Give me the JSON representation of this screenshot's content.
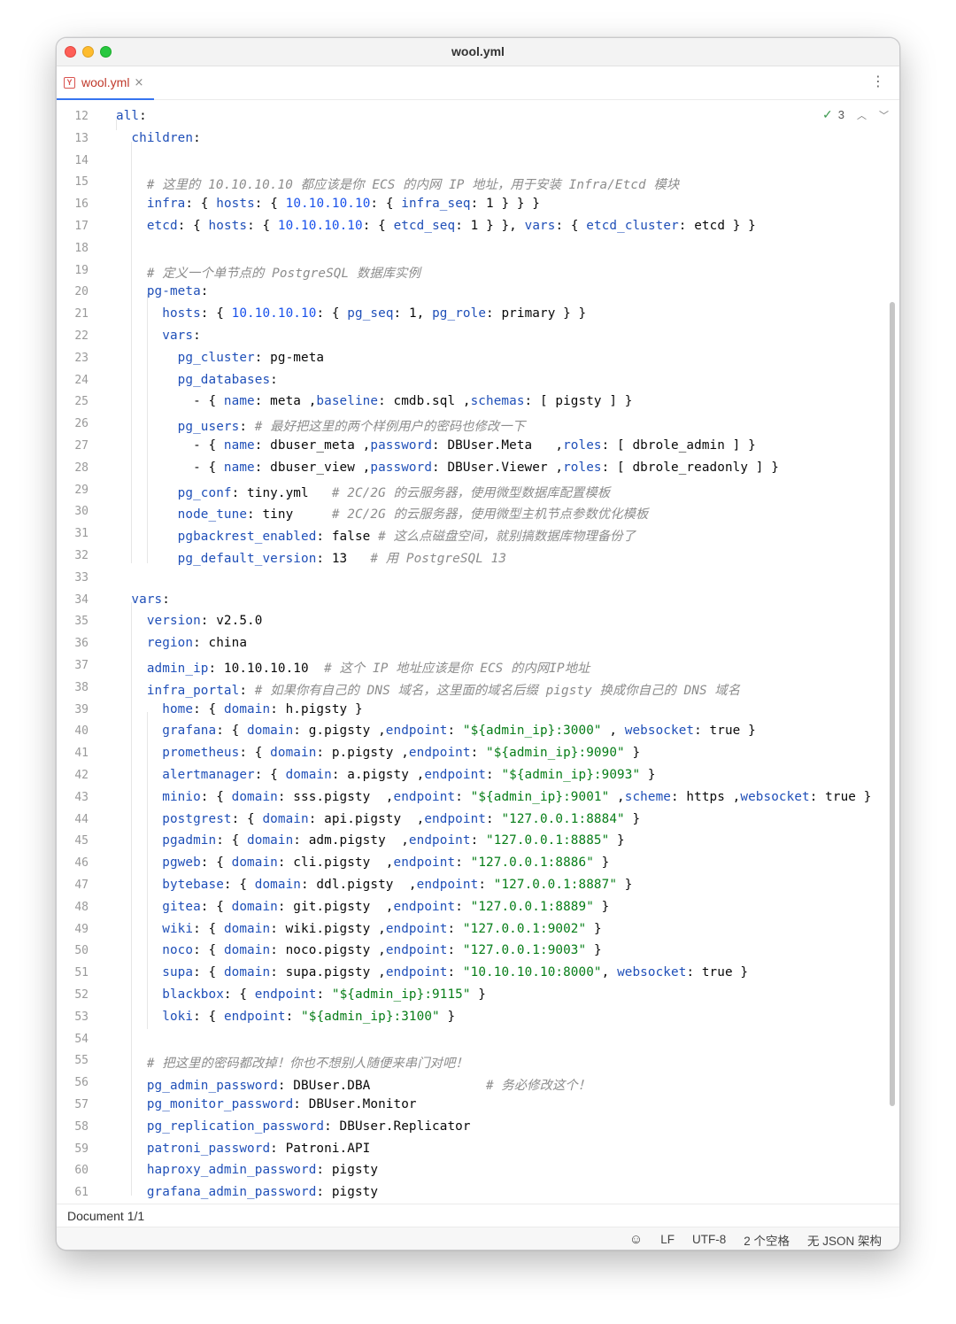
{
  "window": {
    "title": "wool.yml"
  },
  "tab": {
    "label": "wool.yml",
    "close_glyph": "×",
    "menu_glyph": "⋮"
  },
  "inspections": {
    "count": "3"
  },
  "code": [
    {
      "n": "12",
      "t": [
        [
          "k",
          "all"
        ],
        [
          "p",
          ":"
        ]
      ]
    },
    {
      "n": "13",
      "t": [
        [
          "p",
          "  "
        ],
        [
          "k",
          "children"
        ],
        [
          "p",
          ":"
        ]
      ]
    },
    {
      "n": "14",
      "t": []
    },
    {
      "n": "15",
      "t": [
        [
          "p",
          "    "
        ],
        [
          "c",
          "# 这里的 10.10.10.10 都应该是你 ECS 的内网 IP 地址，用于安装 Infra/Etcd 模块"
        ]
      ]
    },
    {
      "n": "16",
      "t": [
        [
          "p",
          "    "
        ],
        [
          "k",
          "infra"
        ],
        [
          "p",
          ": { "
        ],
        [
          "k",
          "hosts"
        ],
        [
          "p",
          ": { "
        ],
        [
          "n",
          "10.10.10.10"
        ],
        [
          "p",
          ": { "
        ],
        [
          "k",
          "infra_seq"
        ],
        [
          "p",
          ": 1 } } }"
        ]
      ]
    },
    {
      "n": "17",
      "t": [
        [
          "p",
          "    "
        ],
        [
          "k",
          "etcd"
        ],
        [
          "p",
          ": { "
        ],
        [
          "k",
          "hosts"
        ],
        [
          "p",
          ": { "
        ],
        [
          "n",
          "10.10.10.10"
        ],
        [
          "p",
          ": { "
        ],
        [
          "k",
          "etcd_seq"
        ],
        [
          "p",
          ": 1 } }, "
        ],
        [
          "k",
          "vars"
        ],
        [
          "p",
          ": { "
        ],
        [
          "k",
          "etcd_cluster"
        ],
        [
          "p",
          ": etcd } }"
        ]
      ]
    },
    {
      "n": "18",
      "t": []
    },
    {
      "n": "19",
      "t": [
        [
          "p",
          "    "
        ],
        [
          "c",
          "# 定义一个单节点的 PostgreSQL 数据库实例"
        ]
      ]
    },
    {
      "n": "20",
      "t": [
        [
          "p",
          "    "
        ],
        [
          "k",
          "pg-meta"
        ],
        [
          "p",
          ":"
        ]
      ]
    },
    {
      "n": "21",
      "t": [
        [
          "p",
          "      "
        ],
        [
          "k",
          "hosts"
        ],
        [
          "p",
          ": { "
        ],
        [
          "n",
          "10.10.10.10"
        ],
        [
          "p",
          ": { "
        ],
        [
          "k",
          "pg_seq"
        ],
        [
          "p",
          ": 1, "
        ],
        [
          "k",
          "pg_role"
        ],
        [
          "p",
          ": primary } }"
        ]
      ]
    },
    {
      "n": "22",
      "t": [
        [
          "p",
          "      "
        ],
        [
          "k",
          "vars"
        ],
        [
          "p",
          ":"
        ]
      ]
    },
    {
      "n": "23",
      "t": [
        [
          "p",
          "        "
        ],
        [
          "k",
          "pg_cluster"
        ],
        [
          "p",
          ": pg-meta"
        ]
      ]
    },
    {
      "n": "24",
      "t": [
        [
          "p",
          "        "
        ],
        [
          "k",
          "pg_databases"
        ],
        [
          "p",
          ":"
        ]
      ]
    },
    {
      "n": "25",
      "t": [
        [
          "p",
          "          - { "
        ],
        [
          "k",
          "name"
        ],
        [
          "p",
          ": meta ,"
        ],
        [
          "k",
          "baseline"
        ],
        [
          "p",
          ": cmdb.sql ,"
        ],
        [
          "k",
          "schemas"
        ],
        [
          "p",
          ": [ pigsty ] }"
        ]
      ]
    },
    {
      "n": "26",
      "t": [
        [
          "p",
          "        "
        ],
        [
          "k",
          "pg_users"
        ],
        [
          "p",
          ": "
        ],
        [
          "c",
          "# 最好把这里的两个样例用户的密码也修改一下"
        ]
      ]
    },
    {
      "n": "27",
      "t": [
        [
          "p",
          "          - { "
        ],
        [
          "k",
          "name"
        ],
        [
          "p",
          ": dbuser_meta ,"
        ],
        [
          "k",
          "password"
        ],
        [
          "p",
          ": DBUser.Meta   ,"
        ],
        [
          "k",
          "roles"
        ],
        [
          "p",
          ": [ dbrole_admin ] }"
        ]
      ]
    },
    {
      "n": "28",
      "t": [
        [
          "p",
          "          - { "
        ],
        [
          "k",
          "name"
        ],
        [
          "p",
          ": dbuser_view ,"
        ],
        [
          "k",
          "password"
        ],
        [
          "p",
          ": DBUser.Viewer ,"
        ],
        [
          "k",
          "roles"
        ],
        [
          "p",
          ": [ dbrole_readonly ] }"
        ]
      ]
    },
    {
      "n": "29",
      "t": [
        [
          "p",
          "        "
        ],
        [
          "k",
          "pg_conf"
        ],
        [
          "p",
          ": tiny.yml   "
        ],
        [
          "c",
          "# 2C/2G 的云服务器，使用微型数据库配置模板"
        ]
      ]
    },
    {
      "n": "30",
      "t": [
        [
          "p",
          "        "
        ],
        [
          "k",
          "node_tune"
        ],
        [
          "p",
          ": tiny     "
        ],
        [
          "c",
          "# 2C/2G 的云服务器，使用微型主机节点参数优化模板"
        ]
      ]
    },
    {
      "n": "31",
      "t": [
        [
          "p",
          "        "
        ],
        [
          "k",
          "pgbackrest_enabled"
        ],
        [
          "p",
          ": false "
        ],
        [
          "c",
          "# 这么点磁盘空间，就别搞数据库物理备份了"
        ]
      ]
    },
    {
      "n": "32",
      "t": [
        [
          "p",
          "        "
        ],
        [
          "k",
          "pg_default_version"
        ],
        [
          "p",
          ": 13   "
        ],
        [
          "c",
          "# 用 PostgreSQL 13"
        ]
      ]
    },
    {
      "n": "33",
      "t": []
    },
    {
      "n": "34",
      "t": [
        [
          "p",
          "  "
        ],
        [
          "k",
          "vars"
        ],
        [
          "p",
          ":"
        ]
      ]
    },
    {
      "n": "35",
      "t": [
        [
          "p",
          "    "
        ],
        [
          "k",
          "version"
        ],
        [
          "p",
          ": v2.5.0"
        ]
      ]
    },
    {
      "n": "36",
      "t": [
        [
          "p",
          "    "
        ],
        [
          "k",
          "region"
        ],
        [
          "p",
          ": china"
        ]
      ]
    },
    {
      "n": "37",
      "t": [
        [
          "p",
          "    "
        ],
        [
          "k",
          "admin_ip"
        ],
        [
          "p",
          ": 10.10.10.10  "
        ],
        [
          "c",
          "# 这个 IP 地址应该是你 ECS 的内网IP地址"
        ]
      ]
    },
    {
      "n": "38",
      "t": [
        [
          "p",
          "    "
        ],
        [
          "k",
          "infra_portal"
        ],
        [
          "p",
          ": "
        ],
        [
          "c",
          "# 如果你有自己的 DNS 域名，这里面的域名后缀 pigsty 换成你自己的 DNS 域名"
        ]
      ]
    },
    {
      "n": "39",
      "t": [
        [
          "p",
          "      "
        ],
        [
          "k",
          "home"
        ],
        [
          "p",
          ": { "
        ],
        [
          "k",
          "domain"
        ],
        [
          "p",
          ": h.pigsty }"
        ]
      ]
    },
    {
      "n": "40",
      "t": [
        [
          "p",
          "      "
        ],
        [
          "k",
          "grafana"
        ],
        [
          "p",
          ": { "
        ],
        [
          "k",
          "domain"
        ],
        [
          "p",
          ": g.pigsty ,"
        ],
        [
          "k",
          "endpoint"
        ],
        [
          "p",
          ": "
        ],
        [
          "s",
          "\"${admin_ip}:3000\""
        ],
        [
          "p",
          " , "
        ],
        [
          "k",
          "websocket"
        ],
        [
          "p",
          ": true }"
        ]
      ]
    },
    {
      "n": "41",
      "t": [
        [
          "p",
          "      "
        ],
        [
          "k",
          "prometheus"
        ],
        [
          "p",
          ": { "
        ],
        [
          "k",
          "domain"
        ],
        [
          "p",
          ": p.pigsty ,"
        ],
        [
          "k",
          "endpoint"
        ],
        [
          "p",
          ": "
        ],
        [
          "s",
          "\"${admin_ip}:9090\""
        ],
        [
          "p",
          " }"
        ]
      ]
    },
    {
      "n": "42",
      "t": [
        [
          "p",
          "      "
        ],
        [
          "k",
          "alertmanager"
        ],
        [
          "p",
          ": { "
        ],
        [
          "k",
          "domain"
        ],
        [
          "p",
          ": a.pigsty ,"
        ],
        [
          "k",
          "endpoint"
        ],
        [
          "p",
          ": "
        ],
        [
          "s",
          "\"${admin_ip}:9093\""
        ],
        [
          "p",
          " }"
        ]
      ]
    },
    {
      "n": "43",
      "t": [
        [
          "p",
          "      "
        ],
        [
          "k",
          "minio"
        ],
        [
          "p",
          ": { "
        ],
        [
          "k",
          "domain"
        ],
        [
          "p",
          ": sss.pigsty  ,"
        ],
        [
          "k",
          "endpoint"
        ],
        [
          "p",
          ": "
        ],
        [
          "s",
          "\"${admin_ip}:9001\""
        ],
        [
          "p",
          " ,"
        ],
        [
          "k",
          "scheme"
        ],
        [
          "p",
          ": https ,"
        ],
        [
          "k",
          "websocket"
        ],
        [
          "p",
          ": true }"
        ]
      ]
    },
    {
      "n": "44",
      "t": [
        [
          "p",
          "      "
        ],
        [
          "k",
          "postgrest"
        ],
        [
          "p",
          ": { "
        ],
        [
          "k",
          "domain"
        ],
        [
          "p",
          ": api.pigsty  ,"
        ],
        [
          "k",
          "endpoint"
        ],
        [
          "p",
          ": "
        ],
        [
          "s",
          "\"127.0.0.1:8884\""
        ],
        [
          "p",
          " }"
        ]
      ]
    },
    {
      "n": "45",
      "t": [
        [
          "p",
          "      "
        ],
        [
          "k",
          "pgadmin"
        ],
        [
          "p",
          ": { "
        ],
        [
          "k",
          "domain"
        ],
        [
          "p",
          ": adm.pigsty  ,"
        ],
        [
          "k",
          "endpoint"
        ],
        [
          "p",
          ": "
        ],
        [
          "s",
          "\"127.0.0.1:8885\""
        ],
        [
          "p",
          " }"
        ]
      ]
    },
    {
      "n": "46",
      "t": [
        [
          "p",
          "      "
        ],
        [
          "k",
          "pgweb"
        ],
        [
          "p",
          ": { "
        ],
        [
          "k",
          "domain"
        ],
        [
          "p",
          ": cli.pigsty  ,"
        ],
        [
          "k",
          "endpoint"
        ],
        [
          "p",
          ": "
        ],
        [
          "s",
          "\"127.0.0.1:8886\""
        ],
        [
          "p",
          " }"
        ]
      ]
    },
    {
      "n": "47",
      "t": [
        [
          "p",
          "      "
        ],
        [
          "k",
          "bytebase"
        ],
        [
          "p",
          ": { "
        ],
        [
          "k",
          "domain"
        ],
        [
          "p",
          ": ddl.pigsty  ,"
        ],
        [
          "k",
          "endpoint"
        ],
        [
          "p",
          ": "
        ],
        [
          "s",
          "\"127.0.0.1:8887\""
        ],
        [
          "p",
          " }"
        ]
      ]
    },
    {
      "n": "48",
      "t": [
        [
          "p",
          "      "
        ],
        [
          "k",
          "gitea"
        ],
        [
          "p",
          ": { "
        ],
        [
          "k",
          "domain"
        ],
        [
          "p",
          ": git.pigsty  ,"
        ],
        [
          "k",
          "endpoint"
        ],
        [
          "p",
          ": "
        ],
        [
          "s",
          "\"127.0.0.1:8889\""
        ],
        [
          "p",
          " }"
        ]
      ]
    },
    {
      "n": "49",
      "t": [
        [
          "p",
          "      "
        ],
        [
          "k",
          "wiki"
        ],
        [
          "p",
          ": { "
        ],
        [
          "k",
          "domain"
        ],
        [
          "p",
          ": wiki.pigsty ,"
        ],
        [
          "k",
          "endpoint"
        ],
        [
          "p",
          ": "
        ],
        [
          "s",
          "\"127.0.0.1:9002\""
        ],
        [
          "p",
          " }"
        ]
      ]
    },
    {
      "n": "50",
      "t": [
        [
          "p",
          "      "
        ],
        [
          "k",
          "noco"
        ],
        [
          "p",
          ": { "
        ],
        [
          "k",
          "domain"
        ],
        [
          "p",
          ": noco.pigsty ,"
        ],
        [
          "k",
          "endpoint"
        ],
        [
          "p",
          ": "
        ],
        [
          "s",
          "\"127.0.0.1:9003\""
        ],
        [
          "p",
          " }"
        ]
      ]
    },
    {
      "n": "51",
      "t": [
        [
          "p",
          "      "
        ],
        [
          "k",
          "supa"
        ],
        [
          "p",
          ": { "
        ],
        [
          "k",
          "domain"
        ],
        [
          "p",
          ": supa.pigsty ,"
        ],
        [
          "k",
          "endpoint"
        ],
        [
          "p",
          ": "
        ],
        [
          "s",
          "\"10.10.10.10:8000\""
        ],
        [
          "p",
          ", "
        ],
        [
          "k",
          "websocket"
        ],
        [
          "p",
          ": true }"
        ]
      ]
    },
    {
      "n": "52",
      "t": [
        [
          "p",
          "      "
        ],
        [
          "k",
          "blackbox"
        ],
        [
          "p",
          ": { "
        ],
        [
          "k",
          "endpoint"
        ],
        [
          "p",
          ": "
        ],
        [
          "s",
          "\"${admin_ip}:9115\""
        ],
        [
          "p",
          " }"
        ]
      ]
    },
    {
      "n": "53",
      "t": [
        [
          "p",
          "      "
        ],
        [
          "k",
          "loki"
        ],
        [
          "p",
          ": { "
        ],
        [
          "k",
          "endpoint"
        ],
        [
          "p",
          ": "
        ],
        [
          "s",
          "\"${admin_ip}:3100\""
        ],
        [
          "p",
          " }"
        ]
      ]
    },
    {
      "n": "54",
      "t": []
    },
    {
      "n": "55",
      "t": [
        [
          "p",
          "    "
        ],
        [
          "c",
          "# 把这里的密码都改掉！你也不想别人随便来串门对吧！"
        ]
      ]
    },
    {
      "n": "56",
      "t": [
        [
          "p",
          "    "
        ],
        [
          "k",
          "pg_admin_password"
        ],
        [
          "p",
          ": DBUser.DBA               "
        ],
        [
          "c",
          "# 务必修改这个！"
        ]
      ]
    },
    {
      "n": "57",
      "t": [
        [
          "p",
          "    "
        ],
        [
          "k",
          "pg_monitor_password"
        ],
        [
          "p",
          ": DBUser.Monitor"
        ]
      ]
    },
    {
      "n": "58",
      "t": [
        [
          "p",
          "    "
        ],
        [
          "k",
          "pg_replication_password"
        ],
        [
          "p",
          ": DBUser.Replicator"
        ]
      ]
    },
    {
      "n": "59",
      "t": [
        [
          "p",
          "    "
        ],
        [
          "k",
          "patroni_password"
        ],
        [
          "p",
          ": Patroni.API"
        ]
      ]
    },
    {
      "n": "60",
      "t": [
        [
          "p",
          "    "
        ],
        [
          "k",
          "haproxy_admin_password"
        ],
        [
          "p",
          ": pigsty"
        ]
      ]
    },
    {
      "n": "61",
      "t": [
        [
          "p",
          "    "
        ],
        [
          "k",
          "grafana_admin_password"
        ],
        [
          "p",
          ": pigsty"
        ]
      ]
    }
  ],
  "breadcrumb": {
    "text": "Document 1/1"
  },
  "status": {
    "line_ending": "LF",
    "encoding": "UTF-8",
    "indent": "2 个空格",
    "schema": "无 JSON 架构"
  },
  "icons": {
    "close": "close-icon",
    "more": "more-vert-icon",
    "inspection": "check-icon",
    "copilot": "copilot-icon"
  }
}
